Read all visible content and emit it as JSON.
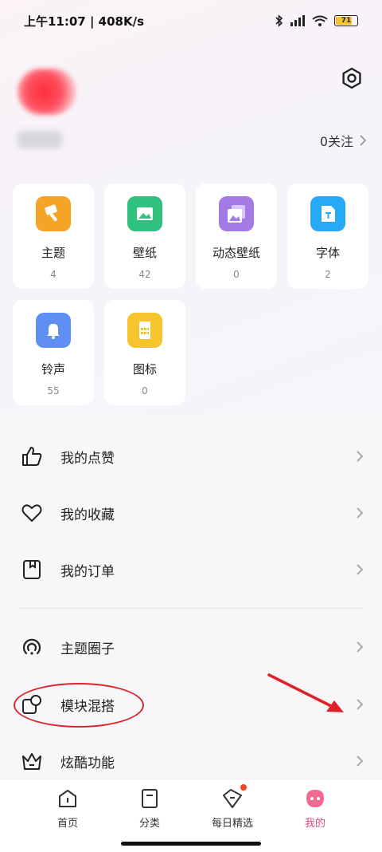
{
  "status_bar": {
    "time_speed": "上午11:07 | 408K/s",
    "battery": "71"
  },
  "profile": {
    "follow_label": "0关注"
  },
  "tiles": [
    {
      "label": "主题",
      "count": "4",
      "color": "#f5a425"
    },
    {
      "label": "壁纸",
      "count": "42",
      "color": "#2ec27e"
    },
    {
      "label": "动态壁纸",
      "count": "0",
      "color": "#a47be6"
    },
    {
      "label": "字体",
      "count": "2",
      "color": "#27aaf5"
    },
    {
      "label": "铃声",
      "count": "55",
      "color": "#5f8ef5"
    },
    {
      "label": "图标",
      "count": "0",
      "color": "#f5c52b"
    }
  ],
  "menu": [
    {
      "label": "我的点赞",
      "icon": "thumbs-up-icon"
    },
    {
      "label": "我的收藏",
      "icon": "heart-icon"
    },
    {
      "label": "我的订单",
      "icon": "bookmark-icon"
    },
    {
      "label": "主题圈子",
      "icon": "circle-community-icon"
    },
    {
      "label": "模块混搭",
      "icon": "module-mix-icon"
    },
    {
      "label": "炫酷功能",
      "icon": "crown-icon"
    }
  ],
  "tabbar": [
    {
      "label": "首页",
      "icon": "home-icon"
    },
    {
      "label": "分类",
      "icon": "category-icon"
    },
    {
      "label": "每日精选",
      "icon": "daily-pick-icon"
    },
    {
      "label": "我的",
      "icon": "profile-icon"
    }
  ],
  "colors": {
    "accent": "#e9487a",
    "annotation": "#d8262c"
  }
}
